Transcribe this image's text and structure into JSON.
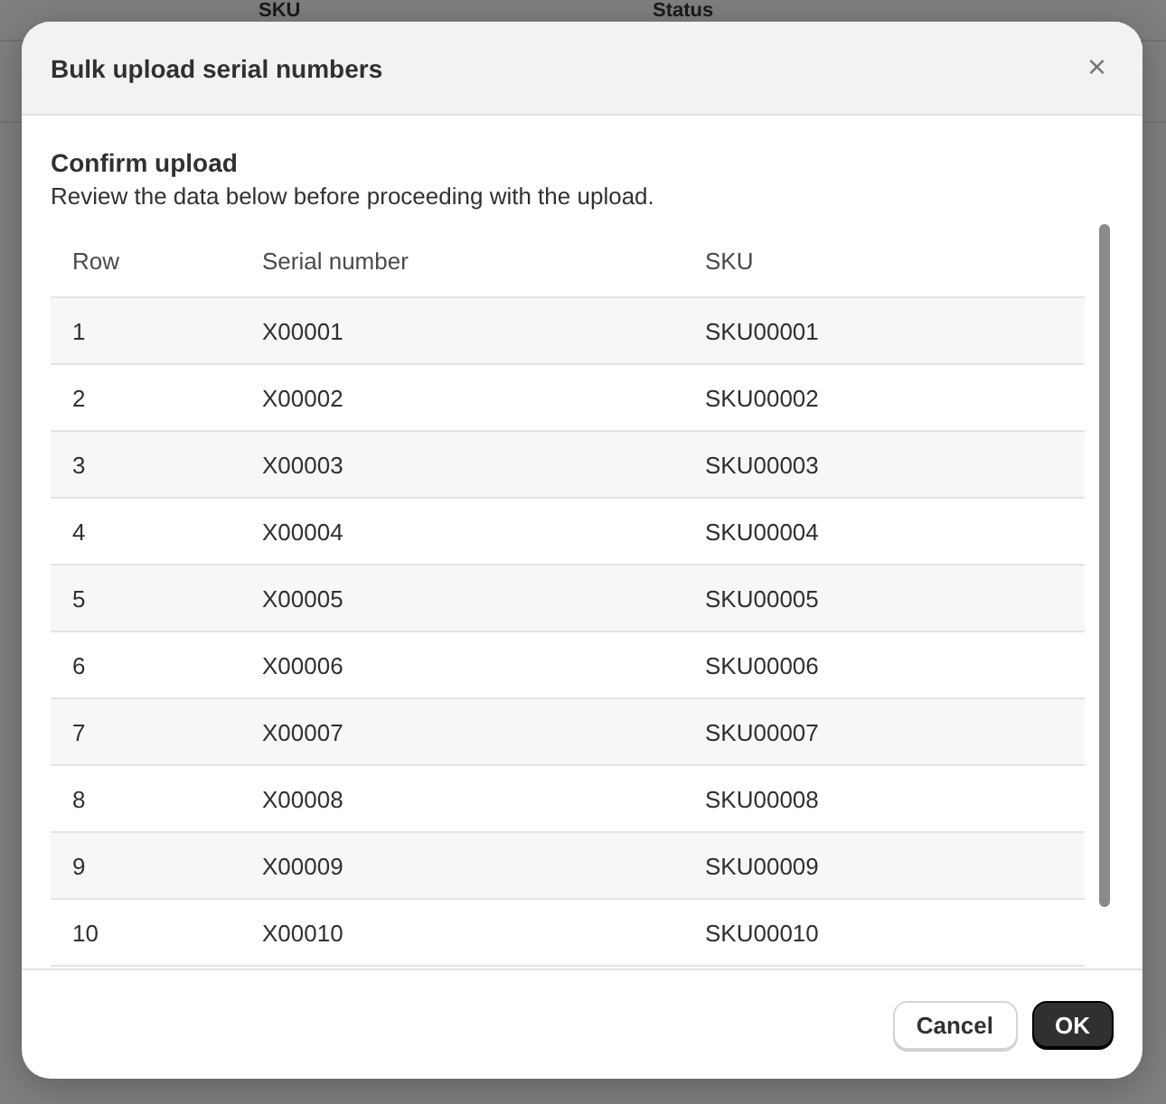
{
  "background": {
    "columns": [
      "SKU",
      "Status"
    ]
  },
  "dialog": {
    "title": "Bulk upload serial numbers",
    "close": "×",
    "heading": "Confirm upload",
    "description": "Review the data below before proceeding with the upload.",
    "table": {
      "columns": [
        "Row",
        "Serial number",
        "SKU"
      ],
      "rows": [
        [
          "1",
          "X00001",
          "SKU00001"
        ],
        [
          "2",
          "X00002",
          "SKU00002"
        ],
        [
          "3",
          "X00003",
          "SKU00003"
        ],
        [
          "4",
          "X00004",
          "SKU00004"
        ],
        [
          "5",
          "X00005",
          "SKU00005"
        ],
        [
          "6",
          "X00006",
          "SKU00006"
        ],
        [
          "7",
          "X00007",
          "SKU00007"
        ],
        [
          "8",
          "X00008",
          "SKU00008"
        ],
        [
          "9",
          "X00009",
          "SKU00009"
        ],
        [
          "10",
          "X00010",
          "SKU00010"
        ]
      ]
    },
    "buttons": [
      {
        "label": "Cancel",
        "kind": "secondary"
      },
      {
        "label": "OK",
        "kind": "primary"
      }
    ]
  }
}
